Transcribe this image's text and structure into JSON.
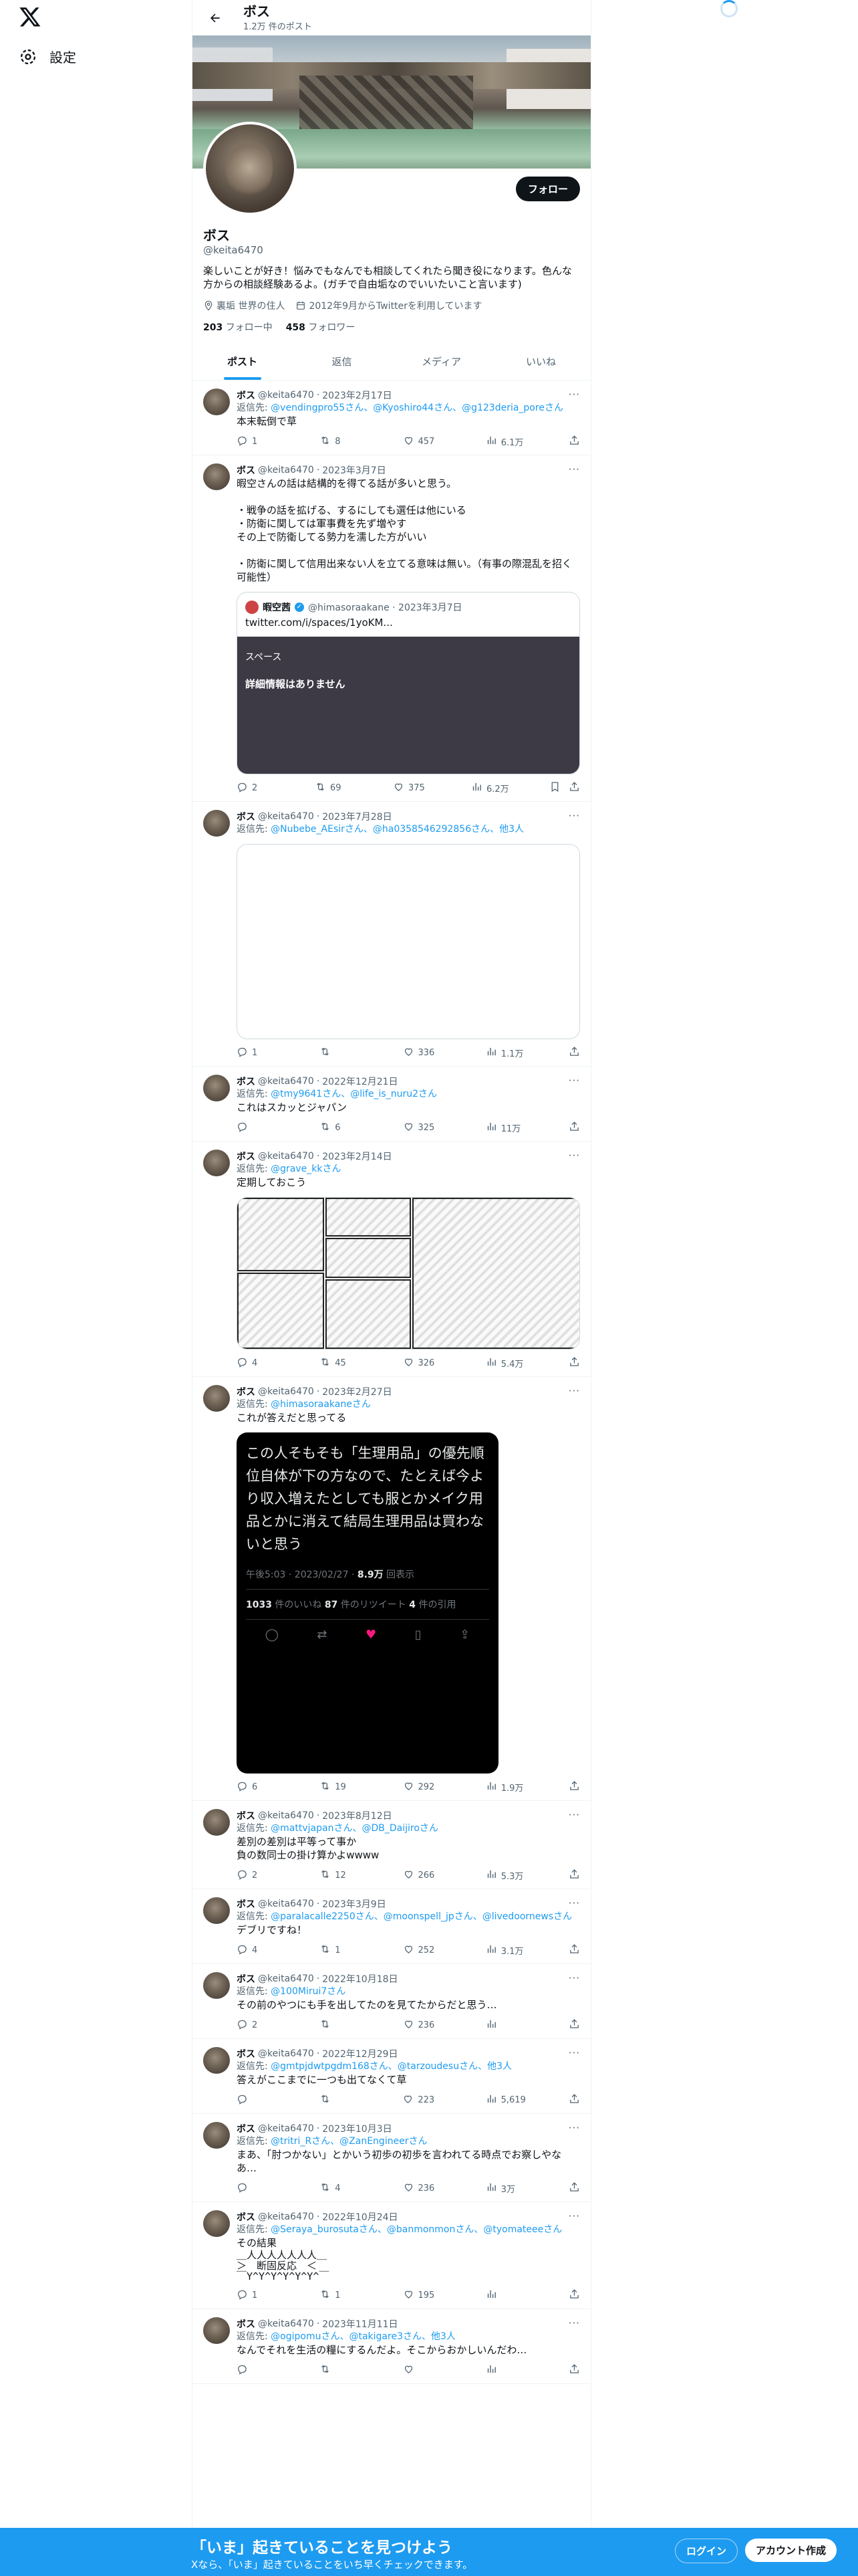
{
  "settings_label": "設定",
  "header": {
    "name": "ボス",
    "post_count": "1.2万 件のポスト"
  },
  "profile": {
    "name": "ボス",
    "handle": "@keita6470",
    "follow_label": "フォロー",
    "bio": "楽しいことが好き！悩みでもなんでも相談してくれたら聞き役になります。色んな方からの相談経験あるよ。(ガチで自由垢なのでいいたいこと言います)",
    "location": "裏垢 世界の住人",
    "joined": "2012年9月からTwitterを利用しています",
    "following_count": "203",
    "following_label": "フォロー中",
    "followers_count": "458",
    "followers_label": "フォロワー"
  },
  "tabs": [
    "ポスト",
    "返信",
    "メディア",
    "いいね"
  ],
  "tweets": [
    {
      "name": "ボス",
      "handle": "@keita6470",
      "date": "2023年2月17日",
      "reply_to": "返信先: ",
      "reply_links": "@vendingpro55さん、@Kyoshiro44さん、@g123deria_poreさん",
      "text": "本末転倒で草",
      "replies": "1",
      "retweets": "8",
      "likes": "457",
      "views": "6.1万"
    },
    {
      "name": "ボス",
      "handle": "@keita6470",
      "date": "2023年3月7日",
      "reply_to": "",
      "reply_links": "",
      "text": "暇空さんの話は結構的を得てる話が多いと思う。\n\n・戦争の話を拡げる、するにしても選任は他にいる\n・防衛に関しては軍事費を先ず増やす\nその上で防衛してる勢力を濡した方がいい\n\n・防衛に関して信用出来ない人を立てる意味は無い。（有事の際混乱を招く可能性）",
      "quote_name": "暇空茜",
      "quote_handle": "@himasoraakane · 2023年3月7日",
      "quote_text": "twitter.com/i/spaces/1yoKM...",
      "space_label": "スペース",
      "space_detail": "詳細情報はありません",
      "replies": "2",
      "retweets": "69",
      "likes": "375",
      "views": "6.2万"
    },
    {
      "name": "ボス",
      "handle": "@keita6470",
      "date": "2023年7月28日",
      "reply_to": "返信先: ",
      "reply_links": "@Nubebe_AEsirさん、@ha0358546292856さん、他3人",
      "text": "",
      "replies": "1",
      "retweets": "",
      "likes": "336",
      "views": "1.1万"
    },
    {
      "name": "ボス",
      "handle": "@keita6470",
      "date": "2022年12月21日",
      "reply_to": "返信先: ",
      "reply_links": "@tmy9641さん、@life_is_nuru2さん",
      "text": "これはスカッとジャパン",
      "replies": "",
      "retweets": "6",
      "likes": "325",
      "views": "11万"
    },
    {
      "name": "ボス",
      "handle": "@keita6470",
      "date": "2023年2月14日",
      "reply_to": "返信先: ",
      "reply_links": "@grave_kkさん",
      "text": "定期しておこう",
      "replies": "4",
      "retweets": "45",
      "likes": "326",
      "views": "5.4万"
    },
    {
      "name": "ボス",
      "handle": "@keita6470",
      "date": "2023年2月27日",
      "reply_to": "返信先: ",
      "reply_links": "@himasoraakaneさん",
      "text": "これが答えだと思ってる",
      "img_text": "この人そもそも「生理用品」の優先順位自体が下の方なので、たとえば今より収入増えたとしても服とかメイク用品とかに消えて結局生理用品は買わないと思う",
      "img_time": "午後5:03 · 2023/02/27 · ",
      "img_views": "8.9万",
      "img_views_label": "回表示",
      "img_likes": "1033",
      "img_likes_label": "件のいいね ",
      "img_rts": "87",
      "img_rts_label": "件のリツイート ",
      "img_quotes": "4",
      "img_quotes_label": "件の引用",
      "replies": "6",
      "retweets": "19",
      "likes": "292",
      "views": "1.9万"
    },
    {
      "name": "ボス",
      "handle": "@keita6470",
      "date": "2023年8月12日",
      "reply_to": "返信先: ",
      "reply_links": "@mattvjapanさん、@DB_Daijiroさん",
      "text": "差別の差別は平等って事か\n負の数同士の掛け算かよwwww",
      "replies": "2",
      "retweets": "12",
      "likes": "266",
      "views": "5.3万"
    },
    {
      "name": "ボス",
      "handle": "@keita6470",
      "date": "2023年3月9日",
      "reply_to": "返信先: ",
      "reply_links": "@paralacalle2250さん、@moonspell_jpさん、@livedoornewsさん",
      "text": "デブリですね！",
      "replies": "4",
      "retweets": "1",
      "likes": "252",
      "views": "3.1万"
    },
    {
      "name": "ボス",
      "handle": "@keita6470",
      "date": "2022年10月18日",
      "reply_to": "返信先: ",
      "reply_links": "@100Mirui7さん",
      "text": "その前のやつにも手を出してたのを見てたからだと思う…",
      "replies": "2",
      "retweets": "",
      "likes": "236",
      "views": ""
    },
    {
      "name": "ボス",
      "handle": "@keita6470",
      "date": "2022年12月29日",
      "reply_to": "返信先: ",
      "reply_links": "@gmtpjdwtpgdm168さん、@tarzoudesuさん、他3人",
      "text": "答えがここまでに一つも出てなくて草",
      "replies": "",
      "retweets": "",
      "likes": "223",
      "views": "5,619"
    },
    {
      "name": "ボス",
      "handle": "@keita6470",
      "date": "2023年10月3日",
      "reply_to": "返信先: ",
      "reply_links": "@tritri_Rさん、@ZanEngineerさん",
      "text": "まあ、「肘つかない」とかいう初歩の初歩を言われてる時点でお察しやな\nあ…",
      "replies": "",
      "retweets": "4",
      "likes": "236",
      "views": "3万"
    },
    {
      "name": "ボス",
      "handle": "@keita6470",
      "date": "2022年10月24日",
      "reply_to": "返信先: ",
      "reply_links": "@Seraya_burosutaさん、@banmonmonさん、@tyomateeeさん",
      "text": "その結果",
      "aa": "＿人人人人人人人＿\n＞　断固反応　＜\n￣Y^Y^Y^Y^Y^Y^￣",
      "replies": "1",
      "retweets": "1",
      "likes": "195",
      "views": ""
    },
    {
      "name": "ボス",
      "handle": "@keita6470",
      "date": "2023年11月11日",
      "reply_to": "返信先: ",
      "reply_links": "@ogipomuさん、@takigare3さん、他3人",
      "text": "なんでそれを生活の糧にするんだよ。そこからおかしいんだわ…",
      "replies": "",
      "retweets": "",
      "likes": "",
      "views": ""
    }
  ],
  "bottom": {
    "title": "「いま」起きていることを見つけよう",
    "subtitle": "Xなら、「いま」起きていることをいち早くチェックできます。",
    "login": "ログイン",
    "signup": "アカウント作成"
  }
}
